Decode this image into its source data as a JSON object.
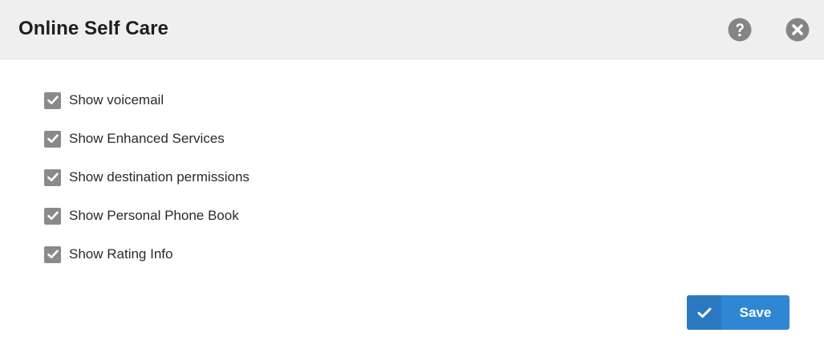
{
  "dialog": {
    "title": "Online Self Care",
    "help_icon": "question-circle-icon",
    "close_icon": "close-circle-icon"
  },
  "options": [
    {
      "label": "Show voicemail",
      "checked": true
    },
    {
      "label": "Show Enhanced Services",
      "checked": true
    },
    {
      "label": "Show destination permissions",
      "checked": true
    },
    {
      "label": "Show Personal Phone Book",
      "checked": true
    },
    {
      "label": "Show Rating Info",
      "checked": true
    }
  ],
  "footer": {
    "save_label": "Save",
    "save_icon": "checkmark-icon"
  },
  "colors": {
    "header_bg": "#efefef",
    "checkbox": "#8a8a8a",
    "icon_gray": "#858585",
    "primary": "#2f86d3"
  }
}
